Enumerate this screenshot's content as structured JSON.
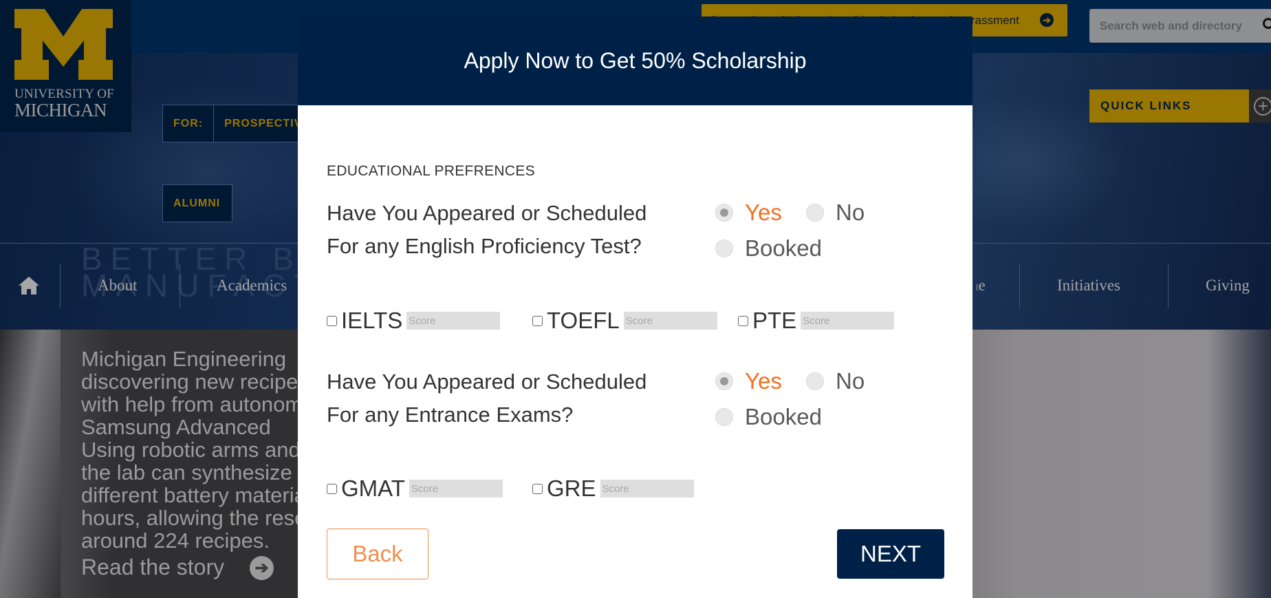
{
  "background": {
    "logo": {
      "line1": "UNIVERSITY OF",
      "line2": "MICHIGAN"
    },
    "alert_banner": {
      "label": "Report Sexual Misconduct, Discrimination, and Harassment",
      "icon": "arrow-right-circle-icon"
    },
    "search": {
      "placeholder": "Search web and directory",
      "icon": "search-icon"
    },
    "quick_links": {
      "label": "QUICK LINKS",
      "icon": "plus-circle-icon"
    },
    "audience_nav": {
      "for_label": "FOR:",
      "items": [
        "PROSPECTIVE",
        "ALUMNI"
      ]
    },
    "main_nav": {
      "home_icon": "home-icon",
      "items": [
        "About",
        "Academics",
        "...e",
        "Initiatives",
        "Giving"
      ]
    },
    "hero_headline": {
      "line1": "BETTER BAT",
      "line2": "MANUFACTU"
    },
    "story": {
      "lines": [
        "Michigan Engineering",
        "discovering new recipes",
        "with help from autonomous",
        "Samsung Advanced",
        "Using robotic arms and",
        "the lab can synthesize",
        "different battery materials",
        "hours, allowing the researchers",
        "around 224 recipes."
      ],
      "read_more": "Read the story"
    }
  },
  "modal": {
    "title": "Apply Now to Get 50% Scholarship",
    "section_label": "EDUCATIONAL PREFRENCES",
    "questions": [
      {
        "line1": "Have You Appeared or Scheduled",
        "line2": "For any English Proficiency Test?",
        "options": [
          "Yes",
          "No",
          "Booked"
        ],
        "selected": "Yes",
        "tests": [
          {
            "name": "IELTS",
            "checked": false,
            "score_placeholder": "Score",
            "score_value": ""
          },
          {
            "name": "TOEFL",
            "checked": false,
            "score_placeholder": "Score",
            "score_value": ""
          },
          {
            "name": "PTE",
            "checked": false,
            "score_placeholder": "Score",
            "score_value": ""
          }
        ]
      },
      {
        "line1": "Have You Appeared or Scheduled",
        "line2": "For any Entrance Exams?",
        "options": [
          "Yes",
          "No",
          "Booked"
        ],
        "selected": "Yes",
        "tests": [
          {
            "name": "GMAT",
            "checked": false,
            "score_placeholder": "Score",
            "score_value": ""
          },
          {
            "name": "GRE",
            "checked": false,
            "score_placeholder": "Score",
            "score_value": ""
          }
        ]
      }
    ],
    "buttons": {
      "back": "Back",
      "next": "NEXT"
    }
  },
  "colors": {
    "navy": "#002147",
    "maize": "#9a7702",
    "accent_orange": "#f5701f",
    "back_button_orange": "#f28e4e"
  }
}
